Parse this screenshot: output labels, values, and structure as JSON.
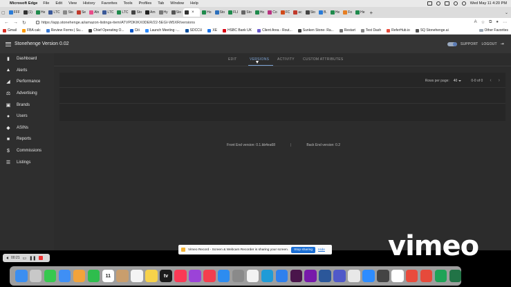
{
  "menubar": {
    "app": "Microsoft Edge",
    "items": [
      "File",
      "Edit",
      "View",
      "History",
      "Favorites",
      "Tools",
      "Profiles",
      "Tab",
      "Window",
      "Help"
    ],
    "clock": "Wed May 11  4:20 PM"
  },
  "browser": {
    "tabs": [
      {
        "label": "FFF",
        "color": "#2a7bd6"
      },
      {
        "label": "(1)",
        "color": "#333333"
      },
      {
        "label": "He",
        "color": "#1f8a4c"
      },
      {
        "label": "LTC",
        "color": "#3b5998"
      },
      {
        "label": "Sto",
        "color": "#888888"
      },
      {
        "label": "Se",
        "color": "#c0392b"
      },
      {
        "label": "Aln",
        "color": "#e84d8a"
      },
      {
        "label": "LTC",
        "color": "#3b5998"
      },
      {
        "label": "LTC",
        "color": "#1f8a4c"
      },
      {
        "label": "Sto",
        "color": "#444444"
      },
      {
        "label": "Am",
        "color": "#222222"
      },
      {
        "label": "Hy",
        "color": "#777777"
      },
      {
        "label": "Sto",
        "color": "#555555"
      },
      {
        "label": "",
        "color": "#333333",
        "active": true
      },
      {
        "label": "Ho",
        "color": "#1f8a4c"
      },
      {
        "label": "Sto",
        "color": "#2c6fbb"
      },
      {
        "label": "FLI",
        "color": "#1f8a4c"
      },
      {
        "label": "Sto",
        "color": "#666666"
      },
      {
        "label": "Ho",
        "color": "#1f8a4c"
      },
      {
        "label": "Co",
        "color": "#b83280"
      },
      {
        "label": "FC",
        "color": "#d04a1a"
      },
      {
        "label": "ac",
        "color": "#c0392b"
      },
      {
        "label": "Sto",
        "color": "#444444"
      },
      {
        "label": "B.",
        "color": "#2a7bd6"
      },
      {
        "label": "He",
        "color": "#1f8a4c"
      },
      {
        "label": "Fo",
        "color": "#e67e22"
      },
      {
        "label": "He",
        "color": "#1f8a4c"
      }
    ],
    "url": "https://app.stonehenge.ai/amazon-listings-item/ATVPDKIKX0DER/22-5EGI-W5XR/versions",
    "favorites": [
      {
        "label": "Gmail",
        "color": "#d93025"
      },
      {
        "label": "FBA calc",
        "color": "#ff9900"
      },
      {
        "label": "Review Forms | Su...",
        "color": "#3a7bd5"
      },
      {
        "label": "Chief Operating O...",
        "color": "#444444"
      },
      {
        "label": "Citi",
        "color": "#0a58ca"
      },
      {
        "label": "Launch Meeting -...",
        "color": "#2d8cff"
      },
      {
        "label": "SDCCU",
        "color": "#0b4f9c"
      },
      {
        "label": "XE",
        "color": "#1a73e8"
      },
      {
        "label": "HSBC Bank UK",
        "color": "#db0011"
      },
      {
        "label": "Client Area - Rout...",
        "color": "#6a5acd"
      },
      {
        "label": "Sunken Stone- Ra...",
        "color": "#444444"
      },
      {
        "label": "Restart",
        "color": "#777777"
      },
      {
        "label": "Test Dash",
        "color": "#888888"
      },
      {
        "label": "ReferHub.io",
        "color": "#e74c3c"
      },
      {
        "label": "SQ Stonehenge.ai",
        "color": "#555555"
      }
    ],
    "other_favorites": "Other Favorites"
  },
  "app": {
    "title": "Stonehenge Version 0.02",
    "support": "SUPPORT",
    "logout": "LOGOUT",
    "sidebar": [
      {
        "label": "Dashboard",
        "icon": "dashboard-icon"
      },
      {
        "label": "Alerts",
        "icon": "bell-icon"
      },
      {
        "label": "Performance",
        "icon": "performance-icon"
      },
      {
        "label": "Advertising",
        "icon": "cart-icon"
      },
      {
        "label": "Brands",
        "icon": "brand-icon"
      },
      {
        "label": "Users",
        "icon": "users-icon"
      },
      {
        "label": "ASINs",
        "icon": "basket-icon"
      },
      {
        "label": "Reports",
        "icon": "reports-icon"
      },
      {
        "label": "Commissions",
        "icon": "dollar-icon"
      },
      {
        "label": "Listings",
        "icon": "list-icon"
      }
    ],
    "tabs": [
      "EDIT",
      "VERSIONS",
      "ACTIVITY",
      "CUSTOM ATTRIBUTES"
    ],
    "active_tab": "VERSIONS",
    "accent_color": "#7ea6d8",
    "pagination": {
      "rows_label": "Rows per page:",
      "rows_value": "40",
      "range": "0-0 of 0"
    },
    "front_end_version": "Front End version: 0.1.bb4ea68",
    "separator": "|",
    "back_end_version": "Back End version: 0.2"
  },
  "recorder": {
    "time": "00:21"
  },
  "share_banner": {
    "text": "Vimeo Record - Screen & Webcam Recorder is sharing your screen.",
    "stop": "Stop sharing",
    "hide": "Hide"
  },
  "watermark": "vimeo",
  "dock": [
    {
      "name": "finder",
      "color": "#3b8ef0"
    },
    {
      "name": "launchpad",
      "color": "#c8c8c8"
    },
    {
      "name": "messages",
      "color": "#37c84f"
    },
    {
      "name": "mail",
      "color": "#3f8ff5"
    },
    {
      "name": "photos",
      "color": "#f2a33a"
    },
    {
      "name": "facetime",
      "color": "#2ebd4d"
    },
    {
      "name": "calendar",
      "color": "#ffffff",
      "text": "11"
    },
    {
      "name": "contacts",
      "color": "#c99e6d"
    },
    {
      "name": "reminders",
      "color": "#f4f4f4"
    },
    {
      "name": "notes",
      "color": "#f7d24a"
    },
    {
      "name": "apple-tv",
      "color": "#1a1a1a",
      "text": "tv"
    },
    {
      "name": "music",
      "color": "#fa3a55"
    },
    {
      "name": "podcasts",
      "color": "#9b43d8"
    },
    {
      "name": "news",
      "color": "#f43e4e"
    },
    {
      "name": "app-store",
      "color": "#2d8cf0"
    },
    {
      "name": "system-preferences",
      "color": "#8a8a8a"
    },
    {
      "name": "chrome",
      "color": "#f2f2f2"
    },
    {
      "name": "edge",
      "color": "#1f9bd7"
    },
    {
      "name": "safari",
      "color": "#2f80ed"
    },
    {
      "name": "slack",
      "color": "#4a154b"
    },
    {
      "name": "onenote",
      "color": "#7719aa"
    },
    {
      "name": "word",
      "color": "#2b579a"
    },
    {
      "name": "teams",
      "color": "#5059c9"
    },
    {
      "name": "spark",
      "color": "#e8e8e8"
    },
    {
      "name": "zoom",
      "color": "#2d8cff"
    },
    {
      "name": "calculator",
      "color": "#444444"
    },
    {
      "name": "notion",
      "color": "#ffffff"
    },
    {
      "name": "screen-recorder",
      "color": "#e94b3c"
    },
    {
      "name": "pdf-expert",
      "color": "#e64a3b"
    },
    {
      "name": "numbers",
      "color": "#1ea357"
    },
    {
      "name": "excel",
      "color": "#217346"
    }
  ]
}
